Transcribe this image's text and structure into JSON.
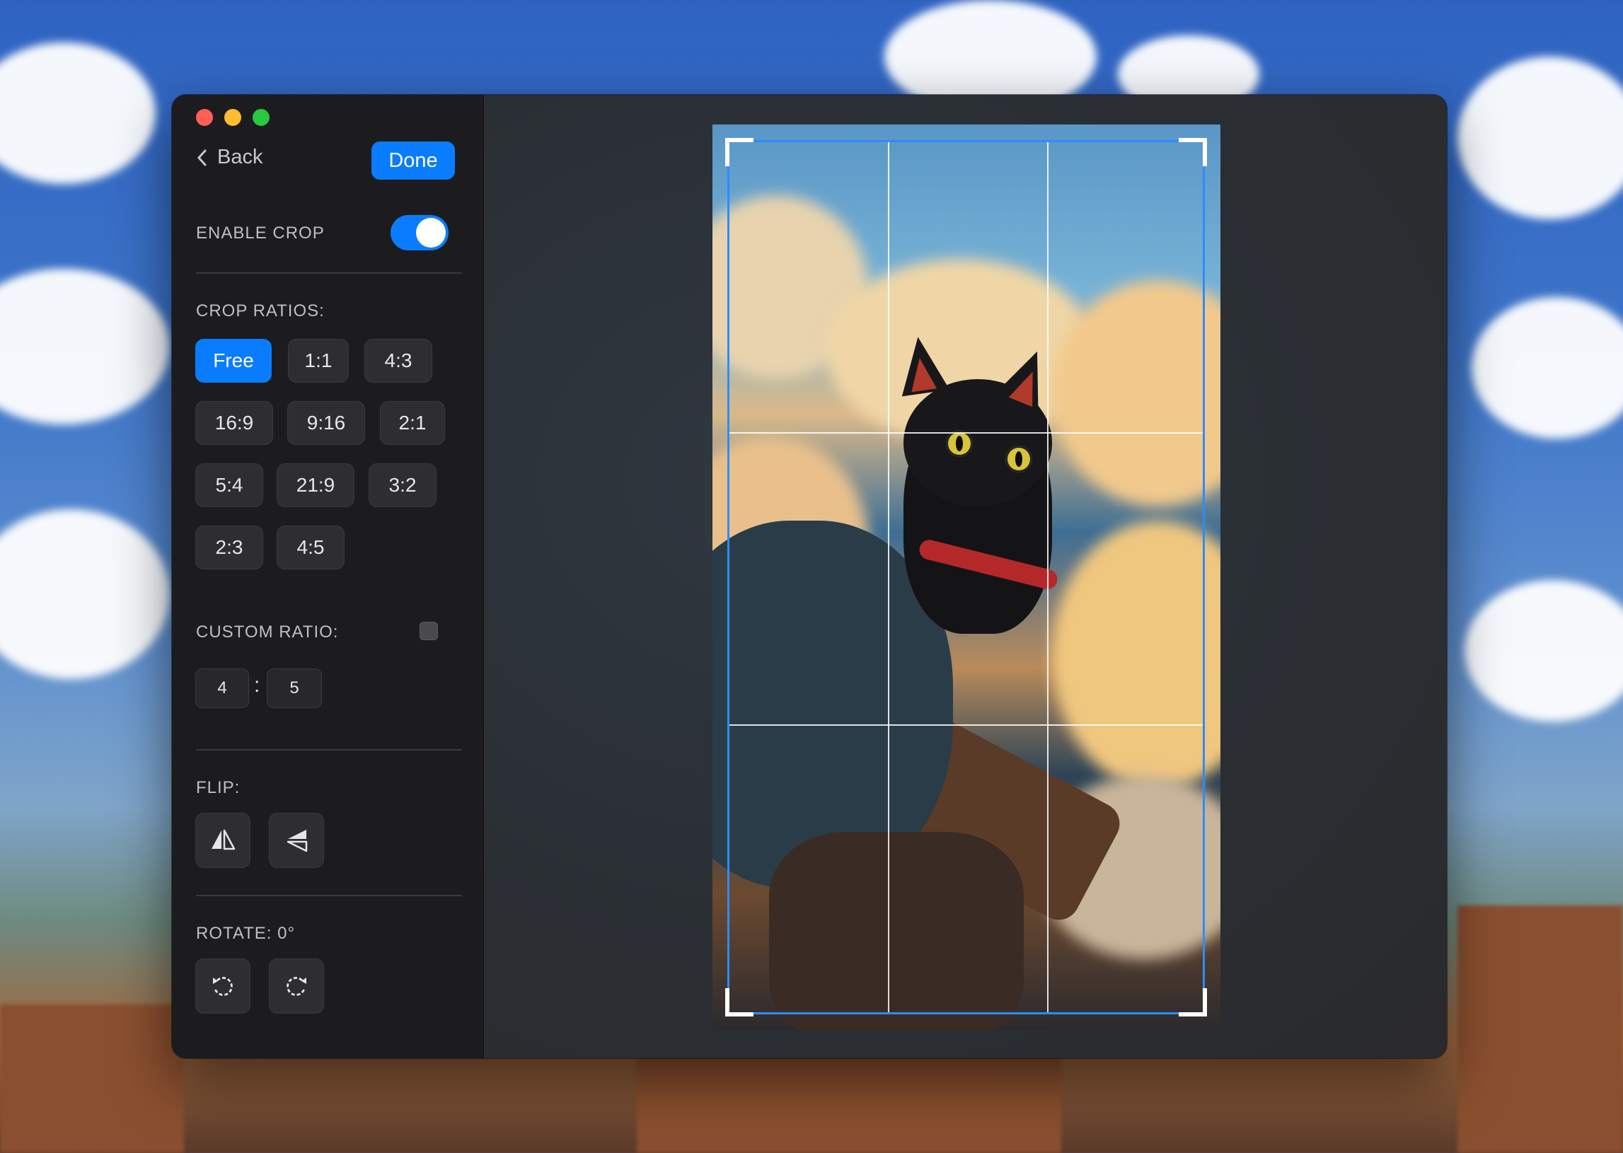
{
  "sidebar": {
    "back_label": "Back",
    "done_label": "Done",
    "enable_crop_label": "ENABLE CROP",
    "enable_crop_on": true,
    "crop_ratios_label": "CROP RATIOS:",
    "ratios": [
      "Free",
      "1:1",
      "4:3",
      "16:9",
      "9:16",
      "2:1",
      "5:4",
      "21:9",
      "3:2",
      "2:3",
      "4:5"
    ],
    "active_ratio": "Free",
    "custom_ratio_label": "CUSTOM RATIO:",
    "custom_ratio_checked": false,
    "custom_ratio_width": "4",
    "custom_ratio_height": "5",
    "custom_ratio_separator": ":",
    "flip_label": "FLIP:",
    "rotate_label": "ROTATE: 0°"
  },
  "icons": {
    "back": "chevron-left-icon",
    "flip_horizontal": "flip-horizontal-icon",
    "flip_vertical": "flip-vertical-icon",
    "rotate_left": "rotate-left-icon",
    "rotate_right": "rotate-right-icon"
  },
  "colors": {
    "accent": "#0a7cff",
    "crop_frame": "#2d8cff",
    "sidebar_bg": "#1c1c1e"
  }
}
